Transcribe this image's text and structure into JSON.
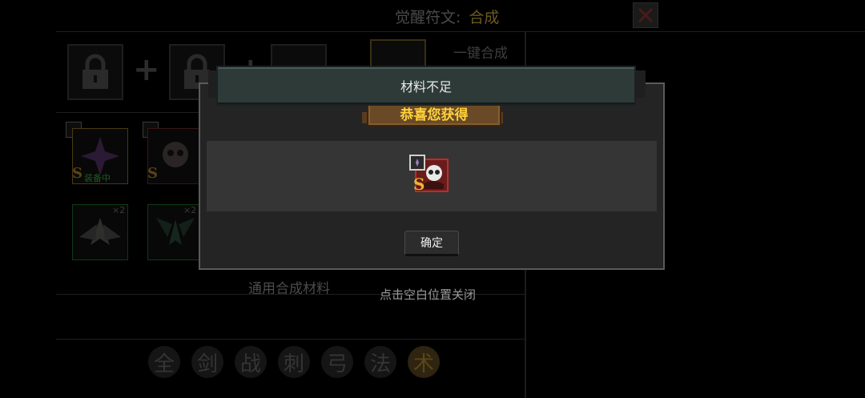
{
  "header": {
    "title": "觉醒符文:",
    "tab_active": "合成",
    "close_icon": "close-x-icon"
  },
  "synthesis": {
    "one_key_label": "一键合成",
    "slots": [
      "lock-icon",
      "lock-icon",
      "empty",
      "result"
    ]
  },
  "inventory": {
    "items": [
      {
        "rarity": "S",
        "status": "装备中",
        "icon": "purple-star-rune-icon"
      },
      {
        "rarity": "S",
        "icon": "skull-rune-icon"
      },
      {
        "count": "×2",
        "icon": "angel-wing-rune-icon"
      },
      {
        "count": "×2",
        "icon": "green-wing-rune-icon"
      }
    ],
    "common_materials_label": "通用合成材料"
  },
  "class_filters": [
    "全",
    "剑",
    "战",
    "刺",
    "弓",
    "法",
    "术"
  ],
  "active_class": "术",
  "notice": {
    "text": "材料不足"
  },
  "dialog": {
    "banner_title": "恭喜您获得",
    "reward": {
      "rarity": "S",
      "icon": "skull-rune-icon"
    },
    "confirm_label": "确定",
    "close_hint": "点击空白位置关闭"
  },
  "colors": {
    "banner_text": "#ffd23a",
    "rarity_s": "#f2b13a",
    "reward_border": "#c12a2a",
    "notice_bg": "#2d3a38"
  }
}
